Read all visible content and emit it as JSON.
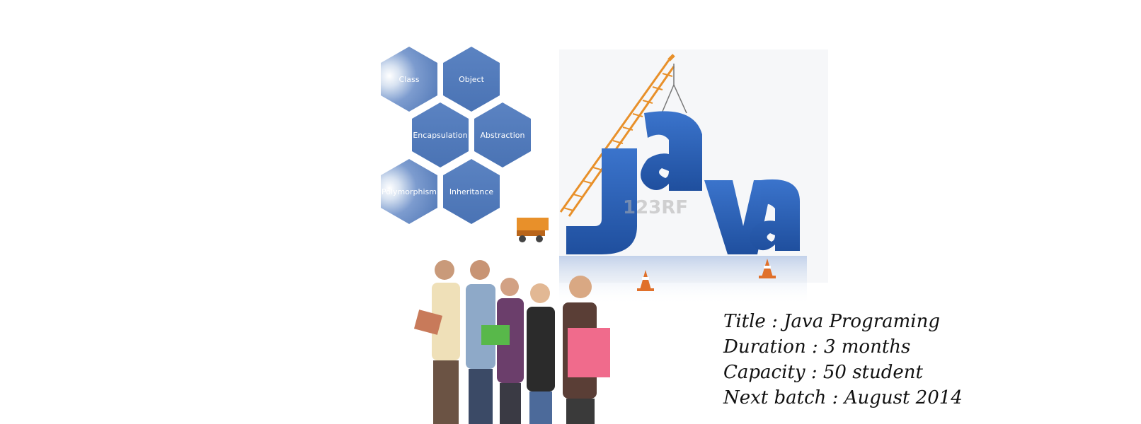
{
  "concepts": {
    "class": "Class",
    "object": "Object",
    "encapsulation": "Encapsulation",
    "abstraction": "Abstraction",
    "polymorphism": "Polymorphism",
    "inheritance": "Inheritance"
  },
  "java_art": {
    "word": "Java",
    "watermark": "123RF",
    "letter_color": "#2e63b8",
    "crane_color": "#e8902a",
    "cone_color": "#e0702a"
  },
  "course": {
    "title": "Title : Java Programing",
    "duration": "Duration : 3 months",
    "capacity": "Capacity : 50 student",
    "next_batch": "Next batch : August 2014"
  }
}
